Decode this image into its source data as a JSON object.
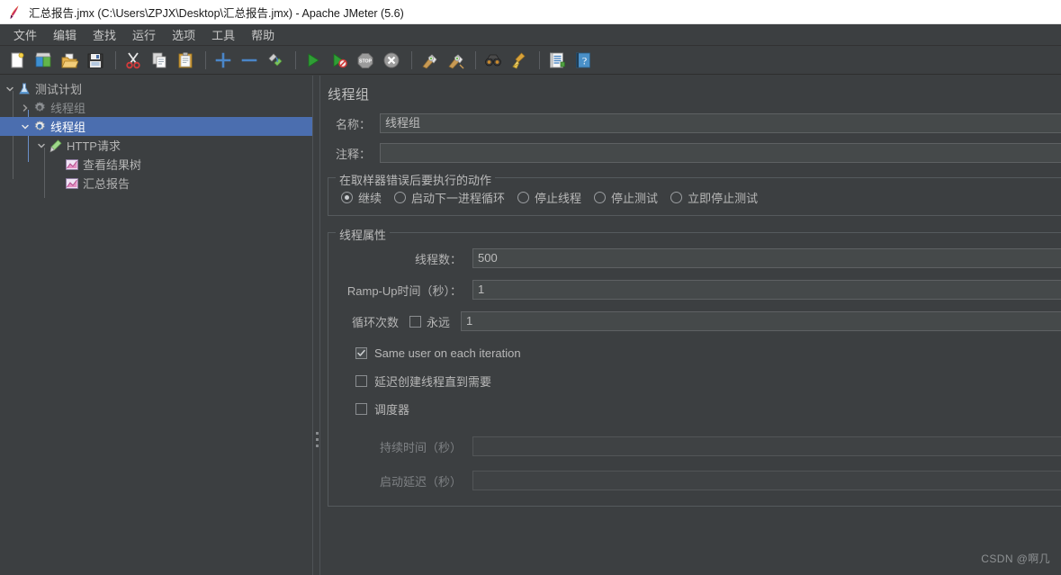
{
  "window": {
    "title": "汇总报告.jmx (C:\\Users\\ZPJX\\Desktop\\汇总报告.jmx) - Apache JMeter (5.6)",
    "app_icon": "jmeter-feather-icon"
  },
  "menubar": {
    "items": [
      {
        "label": "文件",
        "name": "menu-file"
      },
      {
        "label": "编辑",
        "name": "menu-edit"
      },
      {
        "label": "查找",
        "name": "menu-search"
      },
      {
        "label": "运行",
        "name": "menu-run"
      },
      {
        "label": "选项",
        "name": "menu-options"
      },
      {
        "label": "工具",
        "name": "menu-tools"
      },
      {
        "label": "帮助",
        "name": "menu-help"
      }
    ]
  },
  "toolbar": {
    "buttons": [
      {
        "icon": "new-file-icon",
        "group": 1
      },
      {
        "icon": "open-templates-icon",
        "group": 1
      },
      {
        "icon": "open-folder-icon",
        "group": 1
      },
      {
        "icon": "save-icon",
        "group": 1
      },
      {
        "icon": "cut-scissors-icon",
        "group": 2
      },
      {
        "icon": "copy-icon",
        "group": 2
      },
      {
        "icon": "paste-clipboard-icon",
        "group": 2
      },
      {
        "icon": "expand-plus-icon",
        "group": 3
      },
      {
        "icon": "collapse-minus-icon",
        "group": 3
      },
      {
        "icon": "toggle-enable-icon",
        "group": 3
      },
      {
        "icon": "start-play-icon",
        "group": 4
      },
      {
        "icon": "start-no-timers-icon",
        "group": 4
      },
      {
        "icon": "stop-icon",
        "group": 4
      },
      {
        "icon": "shutdown-icon",
        "group": 4
      },
      {
        "icon": "clear-broom-icon",
        "group": 5
      },
      {
        "icon": "clear-all-broom-icon",
        "group": 5
      },
      {
        "icon": "search-binoculars-icon",
        "group": 6
      },
      {
        "icon": "reset-search-broom-icon",
        "group": 6
      },
      {
        "icon": "function-helper-icon",
        "group": 7
      },
      {
        "icon": "help-question-icon",
        "group": 7
      }
    ]
  },
  "tree": {
    "nodes": [
      {
        "label": "测试计划",
        "icon": "test-plan-icon",
        "depth": 0,
        "twisty": "down",
        "selected": false,
        "dim": false
      },
      {
        "label": "线程组",
        "icon": "thread-group-disabled-icon",
        "depth": 1,
        "twisty": "right",
        "selected": false,
        "dim": true
      },
      {
        "label": "线程组",
        "icon": "thread-group-icon",
        "depth": 1,
        "twisty": "down",
        "selected": true,
        "dim": false
      },
      {
        "label": "HTTP请求",
        "icon": "http-request-icon",
        "depth": 2,
        "twisty": "down",
        "selected": false,
        "dim": false
      },
      {
        "label": "查看结果树",
        "icon": "view-results-tree-icon",
        "depth": 3,
        "twisty": "none",
        "selected": false,
        "dim": false
      },
      {
        "label": "汇总报告",
        "icon": "summary-report-icon",
        "depth": 3,
        "twisty": "none",
        "selected": false,
        "dim": false
      }
    ]
  },
  "detail": {
    "title": "线程组",
    "name_label": "名称：",
    "name_value": "线程组",
    "comment_label": "注释：",
    "comment_value": "",
    "error_action": {
      "legend": "在取样器错误后要执行的动作",
      "options": [
        {
          "label": "继续",
          "selected": true
        },
        {
          "label": "启动下一进程循环",
          "selected": false
        },
        {
          "label": "停止线程",
          "selected": false
        },
        {
          "label": "停止测试",
          "selected": false
        },
        {
          "label": "立即停止测试",
          "selected": false
        }
      ]
    },
    "thread_properties": {
      "legend": "线程属性",
      "num_threads_label": "线程数：",
      "num_threads_value": "500",
      "ramp_up_label": "Ramp-Up时间（秒）：",
      "ramp_up_value": "1",
      "loop_label": "循环次数",
      "loop_forever_label": "永远",
      "loop_forever_checked": false,
      "loop_value": "1",
      "same_user_label": "Same user on each iteration",
      "same_user_checked": true,
      "delayed_start_label": "延迟创建线程直到需要",
      "delayed_start_checked": false,
      "scheduler_label": "调度器",
      "scheduler_checked": false,
      "duration_label": "持续时间（秒）",
      "duration_value": "",
      "startup_delay_label": "启动延迟（秒）",
      "startup_delay_value": ""
    }
  },
  "watermark": "CSDN @啊几",
  "colors": {
    "background": "#3c3f41",
    "selection": "#4b6eaf",
    "field_bg": "#45494a",
    "field_border": "#5e6163",
    "text": "#b4b4b4",
    "text_dim": "#7e8184",
    "titlebar_bg": "#ffffff"
  }
}
